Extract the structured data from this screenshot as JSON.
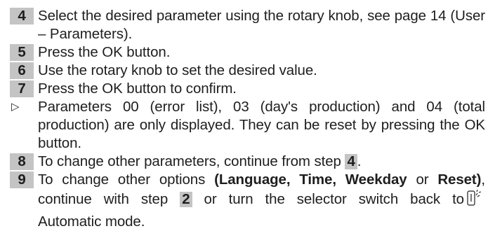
{
  "steps": [
    {
      "num": "4",
      "text": "Select the desired parameter using the rotary knob, see page 14 (User – Parameters)."
    },
    {
      "num": "5",
      "text": "Press the OK button."
    },
    {
      "num": "6",
      "text": "Use the rotary knob to set the desired value."
    },
    {
      "num": "7",
      "text": "Press the OK button to confirm."
    },
    {
      "marker": "▷",
      "text": "Parameters 00 (error list), 03 (day's production) and 04 (total production) are only displayed. They can be reset by pressing the OK button."
    },
    {
      "num": "8",
      "text_before": "To change other parameters, continue from step ",
      "ref": "4",
      "text_after": "."
    },
    {
      "num": "9",
      "line1_a": "To change other options ",
      "bold1": "(Language, Time, Weekday",
      "line1_or": " or ",
      "bold2": "Reset)",
      "line1_end": ",",
      "line2_a": "continue with step ",
      "ref": "2",
      "line2_b": " or turn the selector switch back to",
      "icon": "selector-switch-automatic-icon",
      "line3": "Automatic mode."
    }
  ]
}
